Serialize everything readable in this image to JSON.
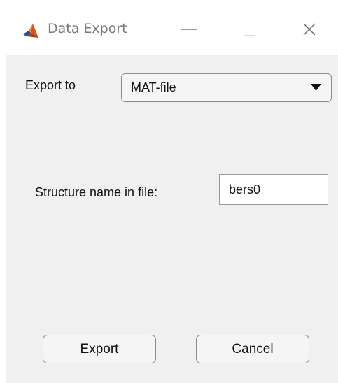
{
  "window": {
    "title": "Data Export",
    "icon": "matlab-logo-icon",
    "controls": [
      "minimize-icon",
      "maximize-icon",
      "close-icon"
    ]
  },
  "export_to": {
    "label": "Export to",
    "selected": "MAT-file"
  },
  "structure": {
    "label": "Structure name in file:",
    "value": "bers0"
  },
  "buttons": {
    "export": "Export",
    "cancel": "Cancel"
  },
  "colors": {
    "dialog_bg": "#f0f0f0",
    "titlebar_bg": "#ffffff",
    "logo_orange": "#d95319",
    "logo_blue": "#1f4e8c"
  }
}
